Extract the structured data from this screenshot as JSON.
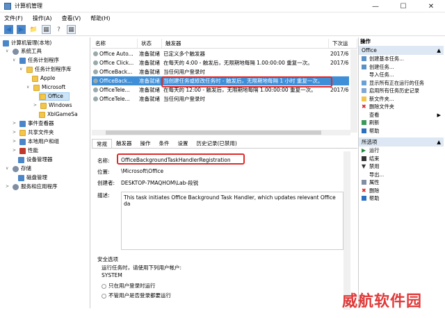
{
  "window": {
    "title": "计算机管理"
  },
  "menu": [
    "文件(F)",
    "操作(A)",
    "查看(V)",
    "帮助(H)"
  ],
  "tree": [
    {
      "label": "计算机管理(本地)",
      "level": 0
    },
    {
      "label": "系统工具",
      "level": 1
    },
    {
      "label": "任务计划程序",
      "level": 2
    },
    {
      "label": "任务计划程序库",
      "level": 3
    },
    {
      "label": "Apple",
      "level": 4
    },
    {
      "label": "Microsoft",
      "level": 4
    },
    {
      "label": "Office",
      "level": 5,
      "selected": true
    },
    {
      "label": "Windows",
      "level": 5
    },
    {
      "label": "XblGameSa",
      "level": 5
    },
    {
      "label": "事件查看器",
      "level": 2
    },
    {
      "label": "共享文件夹",
      "level": 2
    },
    {
      "label": "本地用户和组",
      "level": 2
    },
    {
      "label": "性能",
      "level": 2
    },
    {
      "label": "设备管理器",
      "level": 2
    },
    {
      "label": "存储",
      "level": 1
    },
    {
      "label": "磁盘管理",
      "level": 2
    },
    {
      "label": "服务和应用程序",
      "level": 1
    }
  ],
  "list": {
    "headers": [
      "名称",
      "状态",
      "触发器",
      "下次运"
    ],
    "rows": [
      {
        "name": "Office Auto...",
        "status": "准备就绪",
        "trigger": "已定义多个触发器",
        "next": "2017/6"
      },
      {
        "name": "Office Click...",
        "status": "准备就绪",
        "trigger": "在每天的 4:00 - 触发后，无限期地每隔 1.00:00:00 重复一次。",
        "next": "2017/6"
      },
      {
        "name": "OfficeBack...",
        "status": "准备就绪",
        "trigger": "当任何用户登录时",
        "next": ""
      },
      {
        "name": "OfficeBack...",
        "status": "准备就绪",
        "trigger": "当创建任务或修改任务时 - 触发后，无限期地每隔 1 小时 重复一次。",
        "next": "",
        "selected": true
      },
      {
        "name": "OfficeTele...",
        "status": "准备就绪",
        "trigger": "在每天的 12:00 - 触发后，无限期地每隔 1.00:00:00 重复一次。",
        "next": "2017/6"
      },
      {
        "name": "OfficeTele...",
        "status": "准备就绪",
        "trigger": "当任何用户登录时",
        "next": ""
      }
    ]
  },
  "tabs": [
    "常规",
    "触发器",
    "操作",
    "条件",
    "设置",
    "历史记录(已禁用)"
  ],
  "detail": {
    "name_label": "名称:",
    "name": "OfficeBackgroundTaskHandlerRegistration",
    "location_label": "位置:",
    "location": "\\Microsoft\\Office",
    "author_label": "创建者:",
    "author": "DESKTOP-7MAQHOM\\Lab-段锐",
    "desc_label": "描述:",
    "desc": "This task initiates Office Background Task Handler, which updates relevant Office da",
    "security_label": "安全选项",
    "run_as_label": "运行任务时，请使用下列用户帐户:",
    "run_as": "SYSTEM",
    "option1": "只在用户登录时运行",
    "option2": "不管用户是否登录都要运行"
  },
  "actions": {
    "header": "操作",
    "group1": "Office",
    "items1": [
      "创建基本任务...",
      "创建任务...",
      "导入任务...",
      "显示所有正在运行的任务",
      "启用所有任务历史记录",
      "新文件夹...",
      "删除文件夹",
      "查看",
      "刷新",
      "帮助"
    ],
    "group2": "所选项",
    "items2": [
      "运行",
      "结束",
      "禁用",
      "导出...",
      "属性",
      "删除",
      "帮助"
    ]
  },
  "watermark": "威航软件园"
}
